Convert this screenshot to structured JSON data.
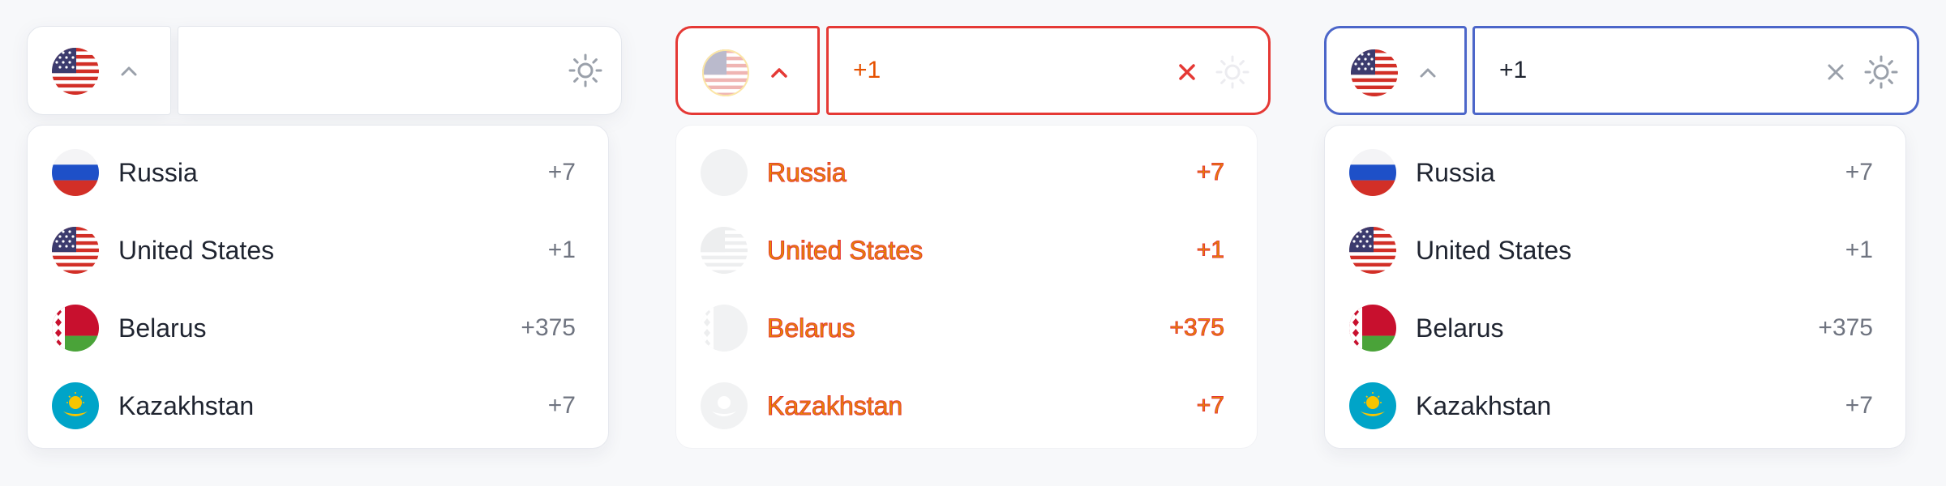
{
  "colors": {
    "accent": "#4c66c9",
    "error": "#e53935",
    "error_text": "#e65100",
    "border": "#e3e6ec",
    "text": "#1f2430",
    "muted": "#6f7480"
  },
  "icons": {
    "selected_flag": "us-flag-icon",
    "chevron": "chevron-up-icon",
    "clear": "close-icon",
    "theme": "sun-icon"
  },
  "widgets": [
    {
      "state": "default",
      "phone_value": "",
      "clear_visible": false,
      "countries": [
        {
          "name": "Russia",
          "code": "+7",
          "flag": "ru-flag-icon"
        },
        {
          "name": "United States",
          "code": "+1",
          "flag": "us-flag-icon"
        },
        {
          "name": "Belarus",
          "code": "+375",
          "flag": "by-flag-icon"
        },
        {
          "name": "Kazakhstan",
          "code": "+7",
          "flag": "kz-flag-icon"
        }
      ]
    },
    {
      "state": "error",
      "phone_value": "+1",
      "clear_visible": true,
      "countries": [
        {
          "name": "Russia",
          "code": "+7",
          "flag": "ru-flag-icon"
        },
        {
          "name": "United States",
          "code": "+1",
          "flag": "us-flag-icon"
        },
        {
          "name": "Belarus",
          "code": "+375",
          "flag": "by-flag-icon"
        },
        {
          "name": "Kazakhstan",
          "code": "+7",
          "flag": "kz-flag-icon"
        }
      ]
    },
    {
      "state": "focused",
      "phone_value": "+1",
      "clear_visible": true,
      "countries": [
        {
          "name": "Russia",
          "code": "+7",
          "flag": "ru-flag-icon"
        },
        {
          "name": "United States",
          "code": "+1",
          "flag": "us-flag-icon"
        },
        {
          "name": "Belarus",
          "code": "+375",
          "flag": "by-flag-icon"
        },
        {
          "name": "Kazakhstan",
          "code": "+7",
          "flag": "kz-flag-icon"
        }
      ]
    }
  ]
}
